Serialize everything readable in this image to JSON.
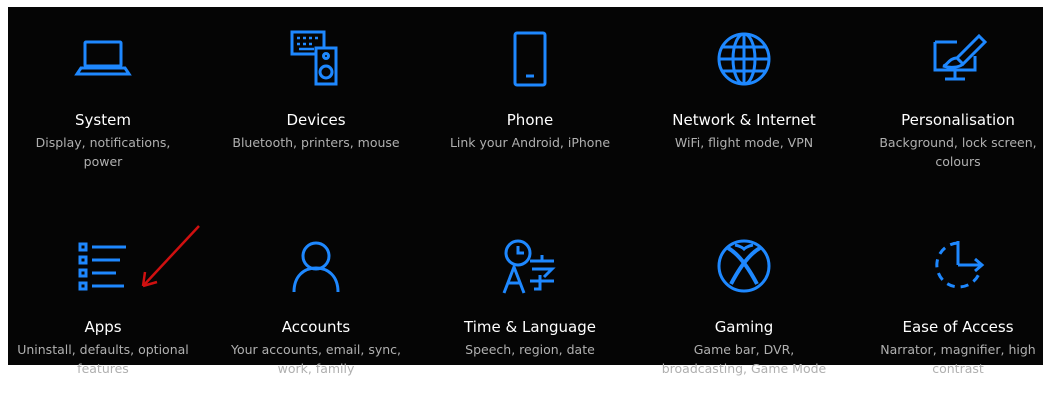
{
  "tiles": [
    {
      "title": "System",
      "desc1": "Display, notifications,",
      "desc2": "power",
      "icon": "laptop-icon"
    },
    {
      "title": "Devices",
      "desc1": "Bluetooth, printers, mouse",
      "desc2": "",
      "icon": "keyboard-speaker-icon"
    },
    {
      "title": "Phone",
      "desc1": "Link your Android, iPhone",
      "desc2": "",
      "icon": "phone-icon"
    },
    {
      "title": "Network & Internet",
      "desc1": "WiFi, flight mode, VPN",
      "desc2": "",
      "icon": "globe-icon"
    },
    {
      "title": "Personalisation",
      "desc1": "Background, lock screen,",
      "desc2": "colours",
      "icon": "paint-monitor-icon"
    },
    {
      "title": "Apps",
      "desc1": "Uninstall, defaults, optional",
      "desc2": "features",
      "icon": "apps-list-icon"
    },
    {
      "title": "Accounts",
      "desc1": "Your accounts, email, sync,",
      "desc2": "work, family",
      "icon": "person-icon"
    },
    {
      "title": "Time & Language",
      "desc1": "Speech, region, date",
      "desc2": "",
      "icon": "time-language-icon"
    },
    {
      "title": "Gaming",
      "desc1": "Game bar, DVR,",
      "desc2": "broadcasting, Game Mode",
      "icon": "xbox-icon"
    },
    {
      "title": "Ease of Access",
      "desc1": "Narrator, magnifier, high",
      "desc2": "contrast",
      "icon": "ease-of-access-icon"
    }
  ],
  "colors": {
    "background": "#050505",
    "accent": "#1e88ff",
    "title": "#ffffff",
    "description": "#b0b0b0",
    "annotation_arrow": "#d01010"
  }
}
